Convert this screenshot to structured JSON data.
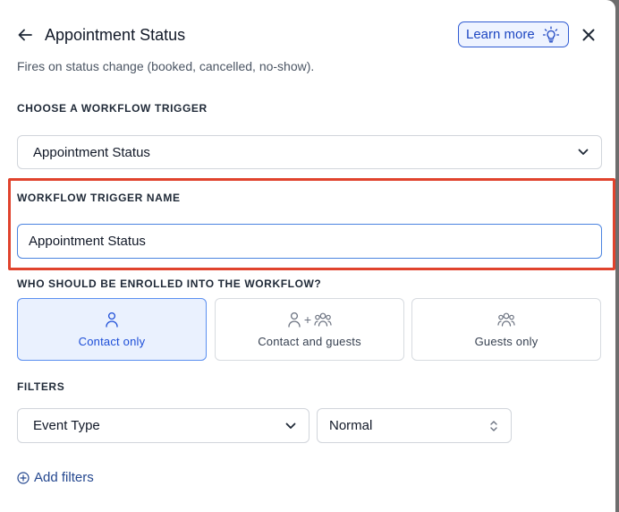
{
  "header": {
    "title": "Appointment Status",
    "learn_more_label": "Learn more",
    "subtitle": "Fires on status change (booked, cancelled, no-show)."
  },
  "trigger": {
    "label": "CHOOSE A WORKFLOW TRIGGER",
    "selected_value": "Appointment Status"
  },
  "trigger_name": {
    "label": "WORKFLOW TRIGGER NAME",
    "value": "Appointment Status"
  },
  "enrollment": {
    "label": "WHO SHOULD BE ENROLLED INTO THE WORKFLOW?",
    "plus_symbol": "+",
    "options": [
      {
        "label": "Contact only",
        "icon": "person-icon",
        "selected": true
      },
      {
        "label": "Contact and guests",
        "icon": "person-plus-group-icon",
        "selected": false
      },
      {
        "label": "Guests only",
        "icon": "group-icon",
        "selected": false
      }
    ]
  },
  "filters": {
    "label": "FILTERS",
    "field_select": "Event Type",
    "value_select": "Normal",
    "add_label": "Add filters"
  },
  "colors": {
    "accent": "#2f5bd3",
    "highlight_box": "#e0432d",
    "selected_card_bg": "#eaf1fe"
  }
}
